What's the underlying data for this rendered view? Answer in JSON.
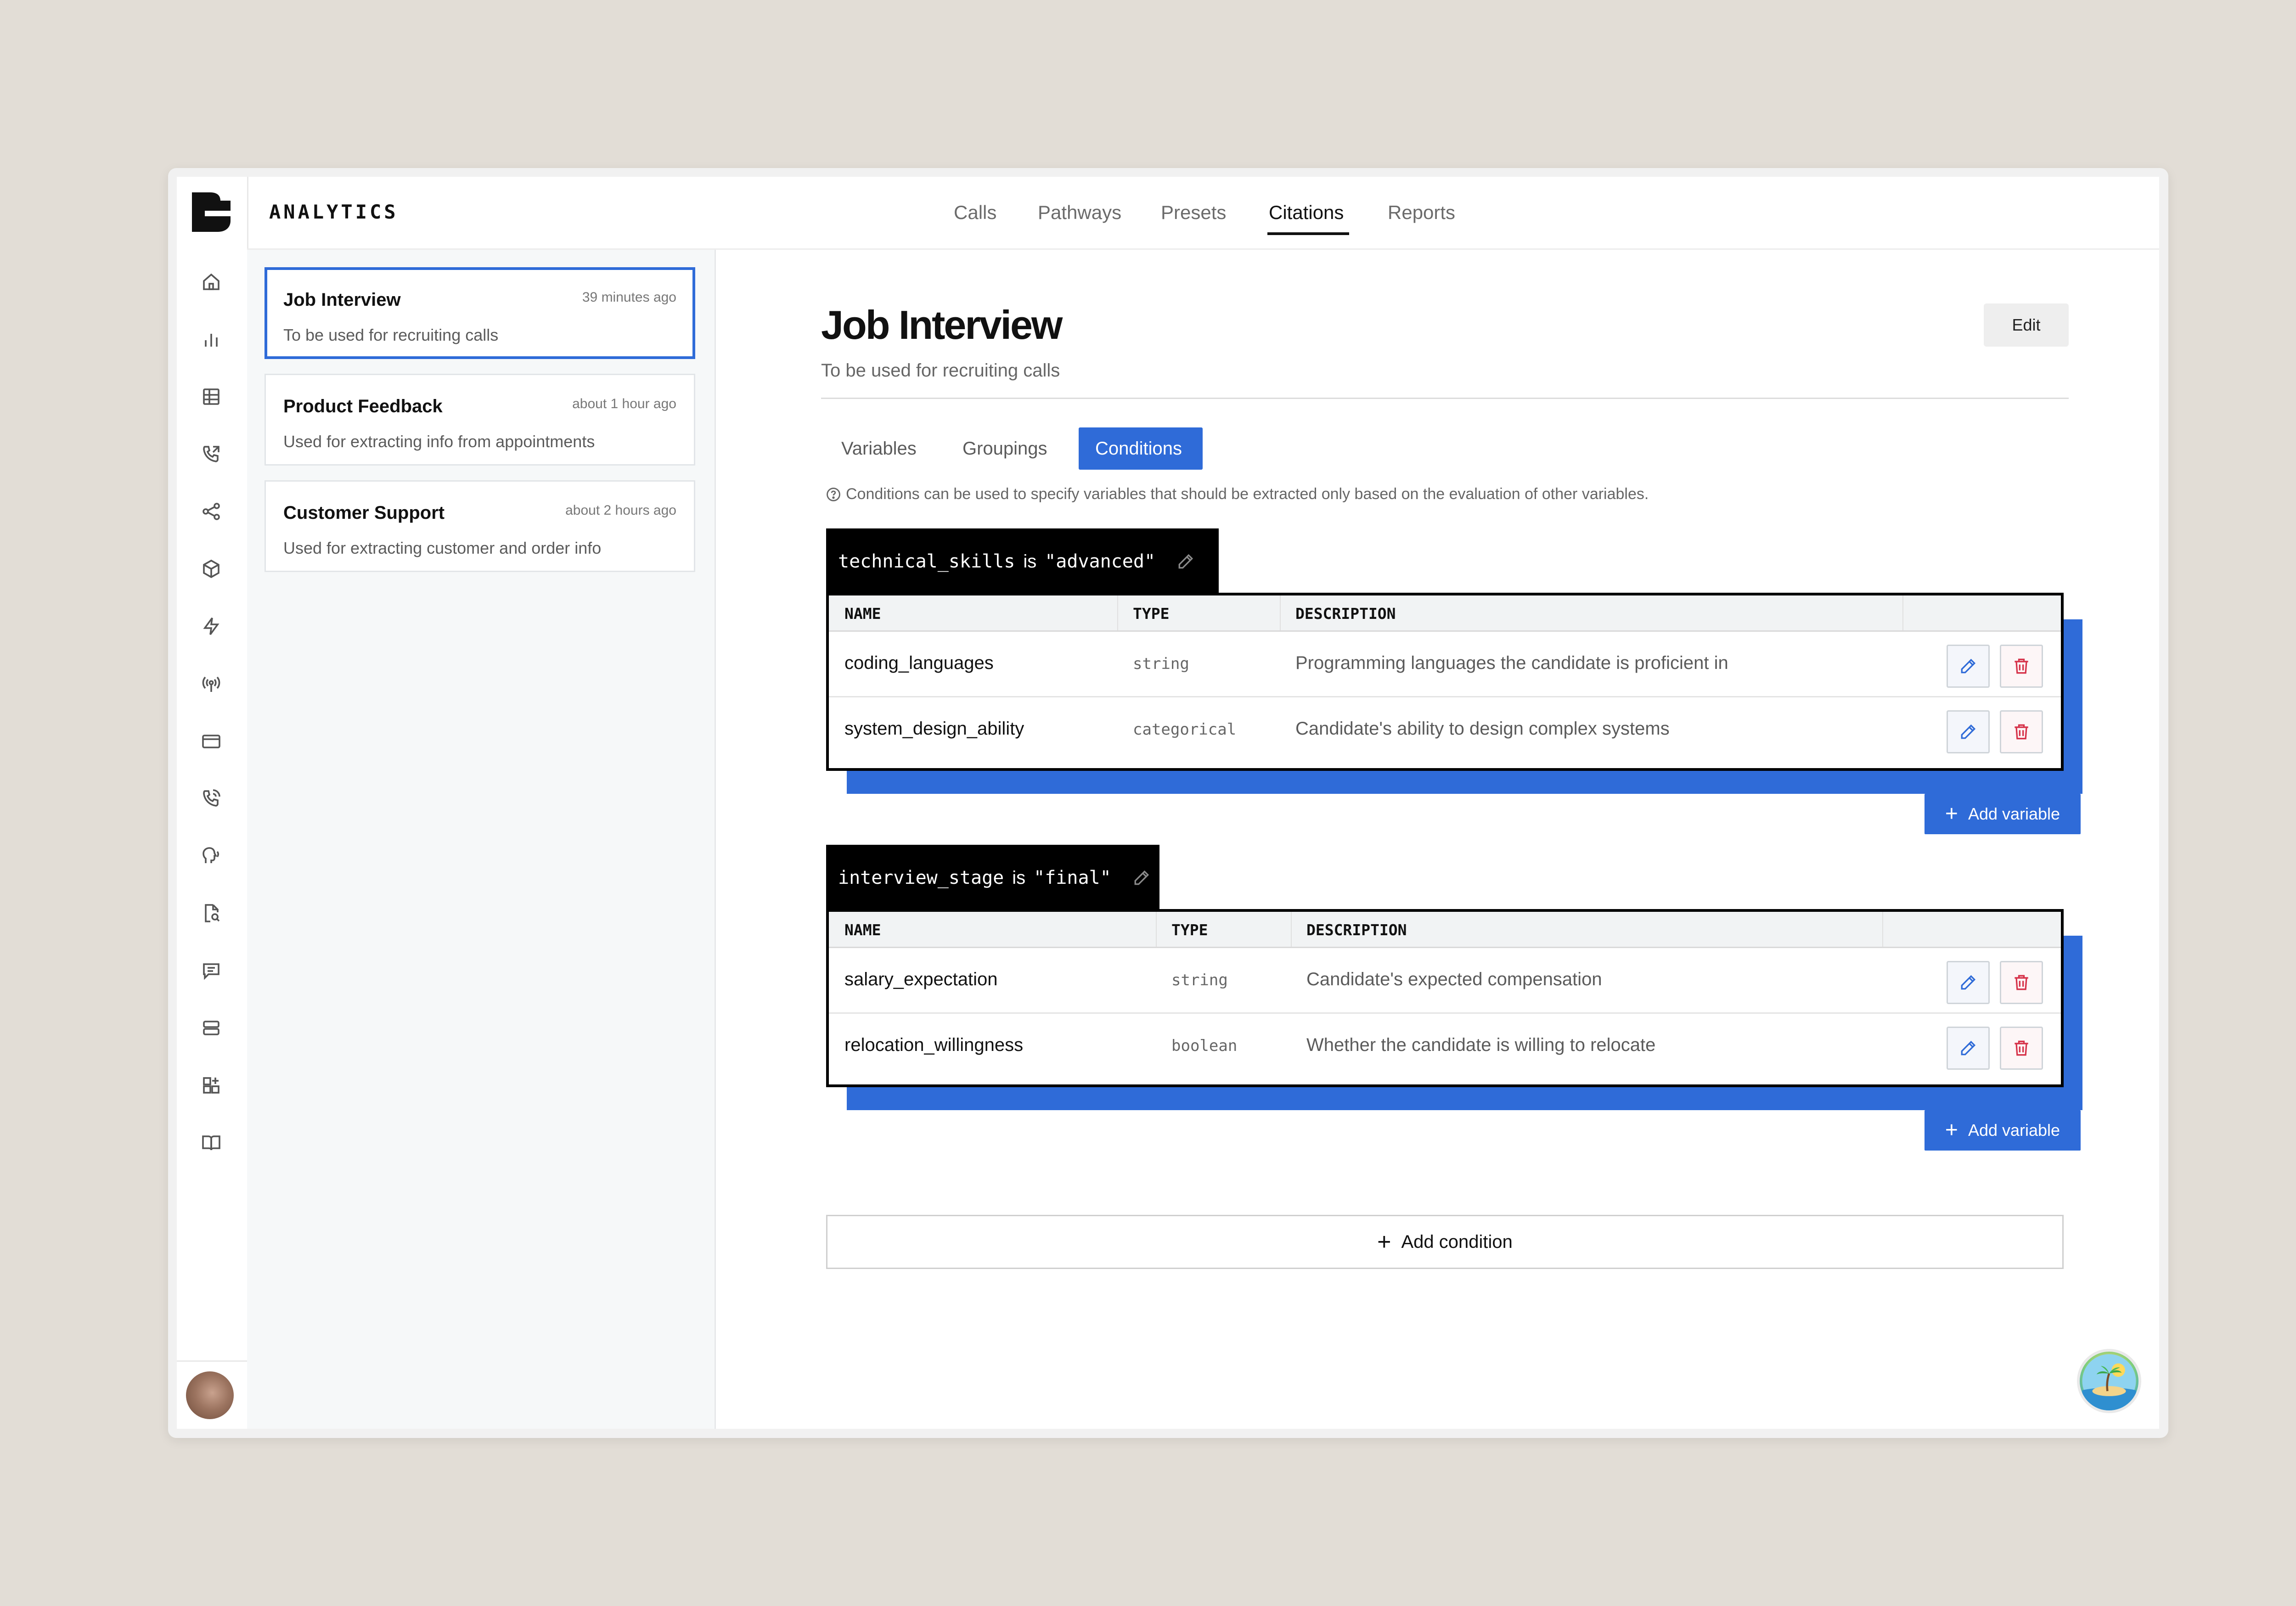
{
  "app": {
    "brand": "ANALYTICS"
  },
  "nav": {
    "items": [
      "Calls",
      "Pathways",
      "Presets",
      "Citations",
      "Reports"
    ],
    "active": "Citations"
  },
  "sidebar_icons": [
    "home-icon",
    "bar-chart-icon",
    "table-icon",
    "phone-outgoing-icon",
    "share-nodes-icon",
    "box-icon",
    "lightning-icon",
    "broadcast-icon",
    "credit-card-icon",
    "phone-call-icon",
    "speech-icon",
    "file-search-icon",
    "message-square-icon",
    "server-icon",
    "grid-plus-icon",
    "book-icon"
  ],
  "list": [
    {
      "title": "Job Interview",
      "description": "To be used for recruiting calls",
      "time": "39 minutes ago",
      "selected": true
    },
    {
      "title": "Product Feedback",
      "description": "Used for extracting info from appointments",
      "time": "about 1 hour ago",
      "selected": false
    },
    {
      "title": "Customer Support",
      "description": "Used for extracting customer and order info",
      "time": "about 2 hours ago",
      "selected": false
    }
  ],
  "detail": {
    "title": "Job Interview",
    "subtitle": "To be used for recruiting calls",
    "edit_label": "Edit",
    "tabs": [
      "Variables",
      "Groupings",
      "Conditions"
    ],
    "active_tab": "Conditions",
    "info": "Conditions can be used to specify variables that should be extracted only based on the evaluation of other variables.",
    "table_headers": [
      "NAME",
      "TYPE",
      "DESCRIPTION"
    ],
    "conditions": [
      {
        "variable": "technical_skills",
        "operator": "is",
        "value": "\"advanced\"",
        "rows": [
          {
            "name": "coding_languages",
            "type": "string",
            "description": "Programming languages the candidate is proficient in"
          },
          {
            "name": "system_design_ability",
            "type": "categorical",
            "description": "Candidate's ability to design complex systems"
          }
        ],
        "add_label": "Add variable"
      },
      {
        "variable": "interview_stage",
        "operator": "is",
        "value": "\"final\"",
        "rows": [
          {
            "name": "salary_expectation",
            "type": "string",
            "description": "Candidate's expected compensation"
          },
          {
            "name": "relocation_willingness",
            "type": "boolean",
            "description": "Whether the candidate is willing to relocate"
          }
        ],
        "add_label": "Add variable"
      }
    ],
    "add_condition_label": "Add condition"
  },
  "colors": {
    "accent": "#2f6bd8",
    "background": "#e2ddd6",
    "delete": "#d6334a"
  }
}
